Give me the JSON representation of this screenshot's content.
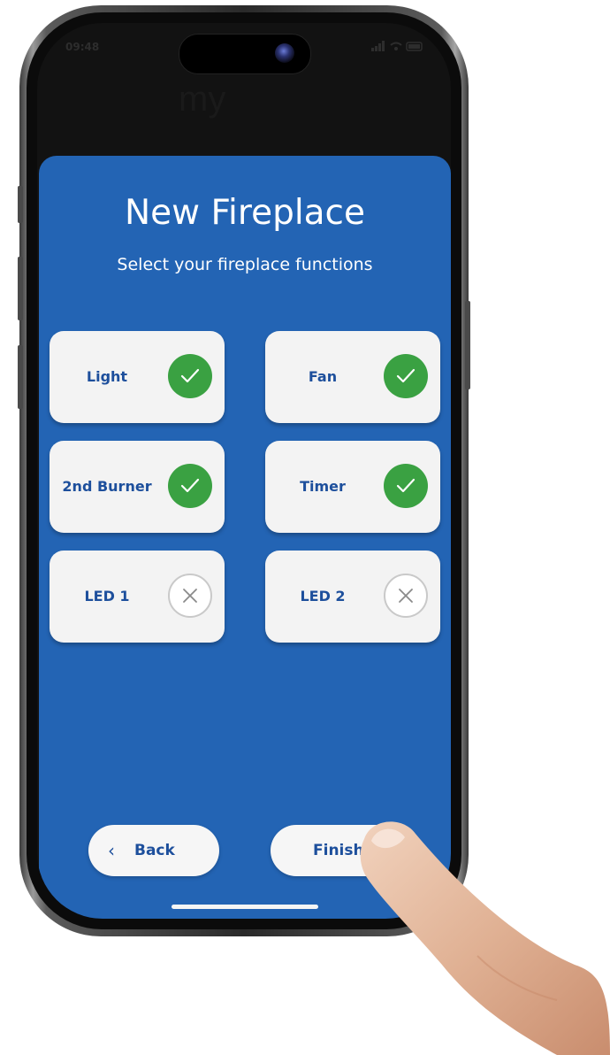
{
  "status_bar": {
    "time": "09:48"
  },
  "background_logo": "my",
  "setup": {
    "title": "New Fireplace",
    "subtitle": "Select your fireplace functions"
  },
  "functions": [
    {
      "label": "Light",
      "enabled": true,
      "toggle_icon": "check-icon"
    },
    {
      "label": "Fan",
      "enabled": true,
      "toggle_icon": "check-icon"
    },
    {
      "label": "2nd Burner",
      "enabled": true,
      "toggle_icon": "check-icon"
    },
    {
      "label": "Timer",
      "enabled": true,
      "toggle_icon": "check-icon"
    },
    {
      "label": "LED 1",
      "enabled": false,
      "toggle_icon": "close-icon"
    },
    {
      "label": "LED 2",
      "enabled": false,
      "toggle_icon": "close-icon"
    }
  ],
  "nav": {
    "back_chevron": "‹",
    "back_label": "Back",
    "finish_label": "Finish"
  },
  "colors": {
    "sheet_background": "#2364b4",
    "enabled_green": "#3aa142",
    "label_blue": "#1d4f9c",
    "card_background": "#f3f3f3"
  }
}
